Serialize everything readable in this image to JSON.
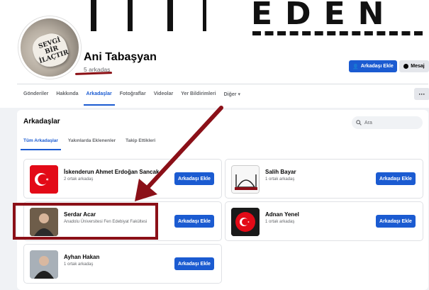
{
  "profile": {
    "name": "Ani Tabaşyan",
    "friend_count": "5 arkadaş",
    "avatar_text": "SEVGİ BİR İLAÇTIR"
  },
  "cover": {
    "letters": "EDEN"
  },
  "actions": {
    "add_friend": "Arkadaşı Ekle",
    "message": "Mesaj"
  },
  "nav_tabs": [
    "Gönderiler",
    "Hakkında",
    "Arkadaşlar",
    "Fotoğraflar",
    "Videolar",
    "Yer Bildirimleri",
    "Diğer ▾"
  ],
  "more_label": "···",
  "friends_panel": {
    "title": "Arkadaşlar",
    "search_placeholder": "Ara",
    "subtabs": [
      "Tüm Arkadaşlar",
      "Yakınlarda Eklenenler",
      "Takip Ettikleri"
    ],
    "add_label": "Arkadaşı Ekle",
    "friends": [
      {
        "name": "İskenderun Ahmet Erdoğan Sancak",
        "detail": "2 ortak arkadaş",
        "avatar": "turkish-flag"
      },
      {
        "name": "Salih Bayar",
        "detail": "1 ortak arkadaş",
        "avatar": "mosque-drawing"
      },
      {
        "name": "Serdar Acar",
        "detail": "Anadolu Üniversitesi Fen Edebiyat Fakültesi",
        "avatar": "person-photo"
      },
      {
        "name": "Adnan Yenel",
        "detail": "1 ortak arkadaş",
        "avatar": "flag-emblem"
      },
      {
        "name": "Ayhan Hakan",
        "detail": "1 ortak arkadaş",
        "avatar": "person-photo"
      }
    ]
  },
  "colors": {
    "accent": "#1b5bd1",
    "annotation": "#8b1018"
  }
}
